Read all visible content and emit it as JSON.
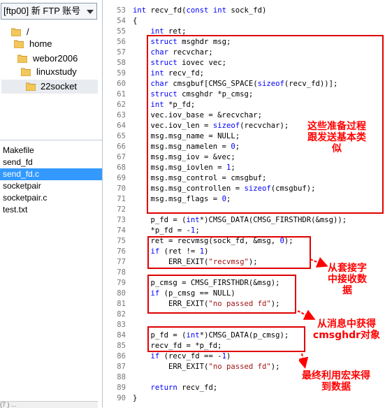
{
  "left_panel": {
    "site_combo": "[ftp00] 新 FTP 账号",
    "tree": [
      {
        "label": "/"
      },
      {
        "label": "home"
      },
      {
        "label": "webor2006"
      },
      {
        "label": "linuxstudy"
      },
      {
        "label": "22socket",
        "selected": true
      }
    ],
    "files": [
      {
        "name": "Makefile"
      },
      {
        "name": "send_fd"
      },
      {
        "name": "send_fd.c",
        "selected": true
      },
      {
        "name": "socketpair"
      },
      {
        "name": "socketpair.c"
      },
      {
        "name": "test.txt"
      }
    ],
    "bottom_stub": "(7 ) ..."
  },
  "colors": {
    "keyword": "#0000ff",
    "string": "#a31515",
    "annotation": "#ff0000",
    "selection": "#3399ff"
  },
  "code": {
    "lines": [
      {
        "n": "53",
        "text": "int recv_fd(const int sock_fd)"
      },
      {
        "n": "54",
        "text": "{"
      },
      {
        "n": "55",
        "text": "    int ret;"
      },
      {
        "n": "56",
        "text": "    struct msghdr msg;"
      },
      {
        "n": "57",
        "text": "    char recvchar;"
      },
      {
        "n": "58",
        "text": "    struct iovec vec;"
      },
      {
        "n": "59",
        "text": "    int recv_fd;"
      },
      {
        "n": "60",
        "text": "    char cmsgbuf[CMSG_SPACE(sizeof(recv_fd))];"
      },
      {
        "n": "61",
        "text": "    struct cmsghdr *p_cmsg;"
      },
      {
        "n": "62",
        "text": "    int *p_fd;"
      },
      {
        "n": "63",
        "text": "    vec.iov_base = &recvchar;"
      },
      {
        "n": "64",
        "text": "    vec.iov_len = sizeof(recvchar);"
      },
      {
        "n": "65",
        "text": "    msg.msg_name = NULL;"
      },
      {
        "n": "66",
        "text": "    msg.msg_namelen = 0;"
      },
      {
        "n": "67",
        "text": "    msg.msg_iov = &vec;"
      },
      {
        "n": "68",
        "text": "    msg.msg_iovlen = 1;"
      },
      {
        "n": "69",
        "text": "    msg.msg_control = cmsgbuf;"
      },
      {
        "n": "70",
        "text": "    msg.msg_controllen = sizeof(cmsgbuf);"
      },
      {
        "n": "71",
        "text": "    msg.msg_flags = 0;"
      },
      {
        "n": "72",
        "text": ""
      },
      {
        "n": "73",
        "text": "    p_fd = (int*)CMSG_DATA(CMSG_FIRSTHDR(&msg));"
      },
      {
        "n": "74",
        "text": "    *p_fd = -1;"
      },
      {
        "n": "75",
        "text": "    ret = recvmsg(sock_fd, &msg, 0);"
      },
      {
        "n": "76",
        "text": "    if (ret != 1)"
      },
      {
        "n": "77",
        "text": "        ERR_EXIT(\"recvmsg\");"
      },
      {
        "n": "78",
        "text": ""
      },
      {
        "n": "79",
        "text": "    p_cmsg = CMSG_FIRSTHDR(&msg);"
      },
      {
        "n": "80",
        "text": "    if (p_cmsg == NULL)"
      },
      {
        "n": "81",
        "text": "        ERR_EXIT(\"no passed fd\");"
      },
      {
        "n": "82",
        "text": ""
      },
      {
        "n": "83",
        "text": ""
      },
      {
        "n": "84",
        "text": "    p_fd = (int*)CMSG_DATA(p_cmsg);"
      },
      {
        "n": "85",
        "text": "    recv_fd = *p_fd;"
      },
      {
        "n": "86",
        "text": "    if (recv_fd == -1)"
      },
      {
        "n": "87",
        "text": "        ERR_EXIT(\"no passed fd\");"
      },
      {
        "n": "88",
        "text": ""
      },
      {
        "n": "89",
        "text": "    return recv_fd;"
      },
      {
        "n": "90",
        "text": "}"
      }
    ]
  },
  "annotations": [
    {
      "text": "这些准备过程跟发送基本类似"
    },
    {
      "text": "从套接字中接收数据"
    },
    {
      "text": "从消息中获得cmsghdr对象"
    },
    {
      "text": "最终利用宏来得到数据"
    }
  ]
}
